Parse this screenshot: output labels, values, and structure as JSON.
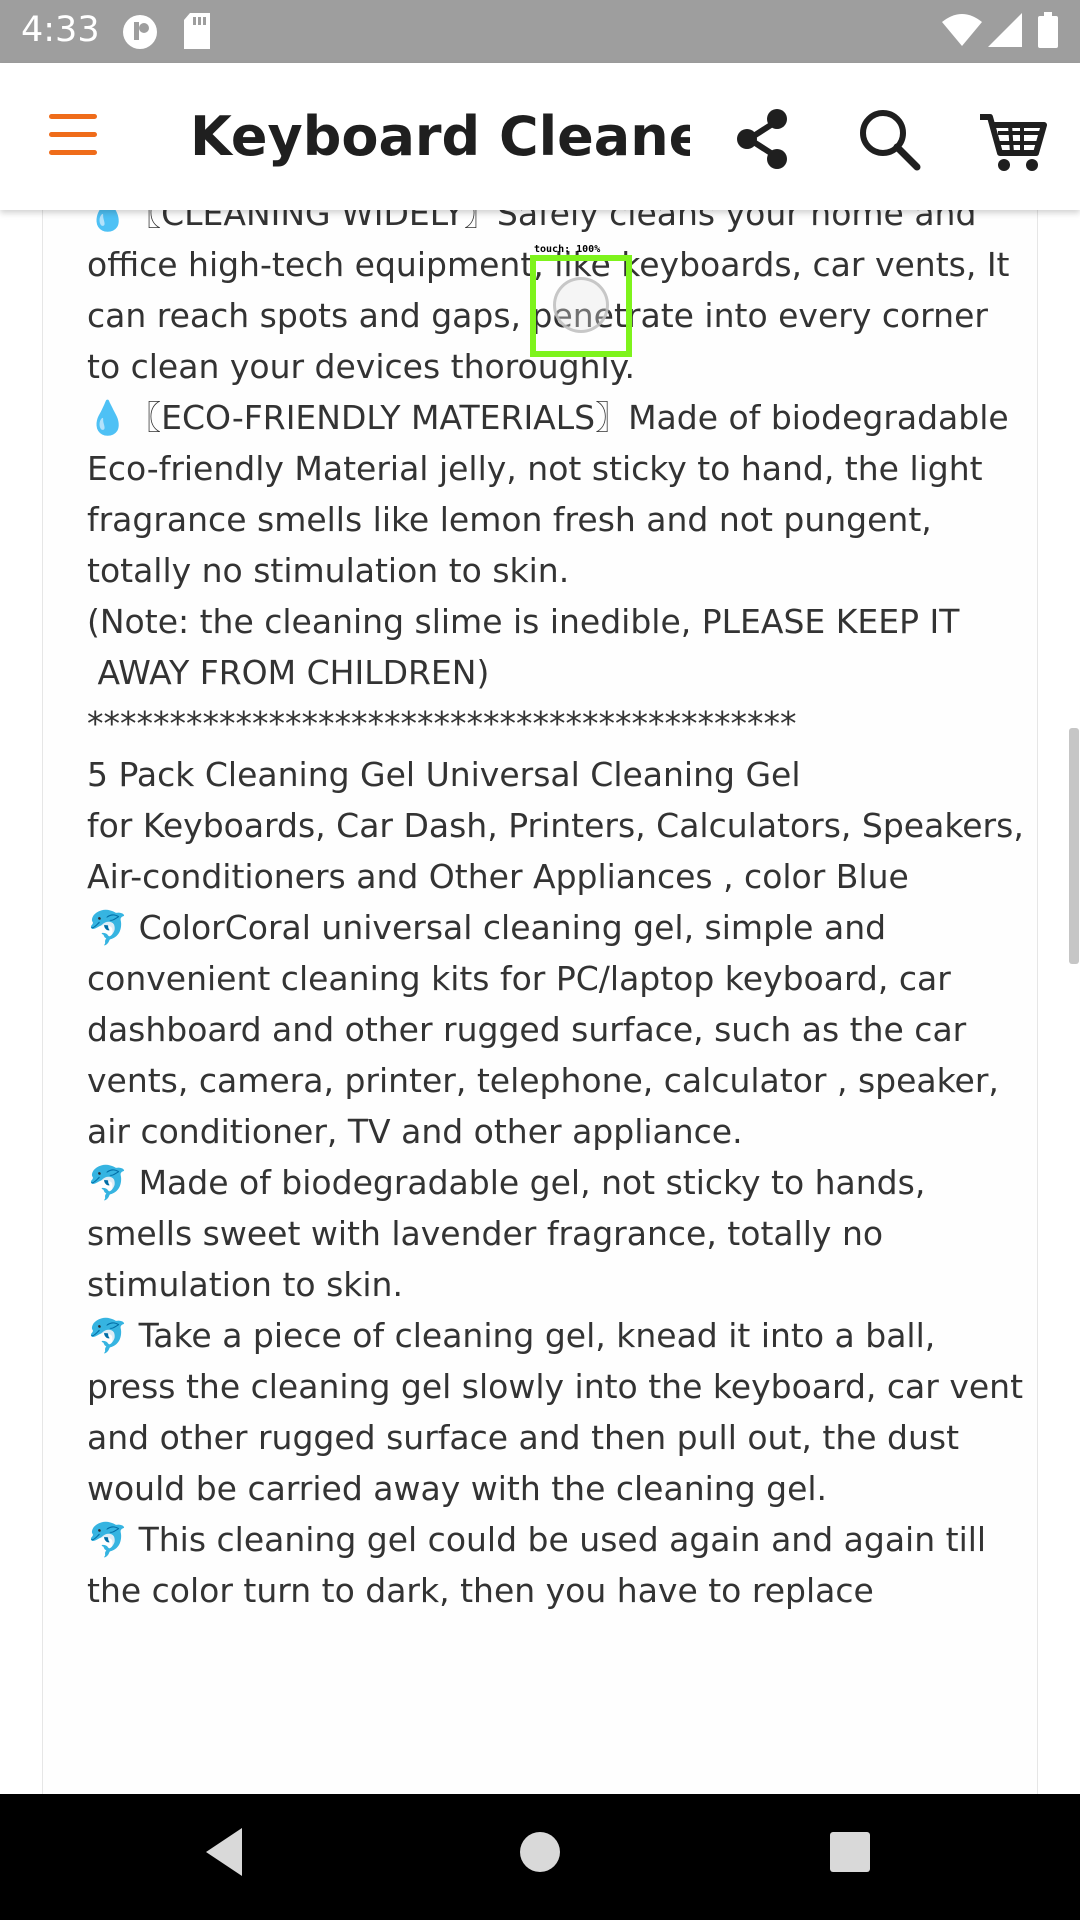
{
  "status_bar": {
    "time": "4:33"
  },
  "app_bar": {
    "title": "Keyboard Cleane...",
    "accent_color": "#ef6c1a",
    "icons": [
      "menu-icon",
      "share-icon",
      "search-icon",
      "cart-icon"
    ]
  },
  "description": {
    "text": "💧〖CLEANING WIDELY〗Safely cleans your home and office high-tech equipment, like keyboards, car vents, It can reach spots and gaps, penetrate into every corner to clean your devices thoroughly.\n💧〖ECO-FRIENDLY MATERIALS〗Made of biodegradable Eco-friendly Material jelly, not sticky to hand, the light fragrance smells like lemon fresh and not pungent, totally no stimulation to skin.\n(Note: the cleaning slime is inedible, PLEASE KEEP IT\n AWAY FROM CHILDREN)\n*******************************************\n5 Pack Cleaning Gel Universal Cleaning Gel\nfor Keyboards, Car Dash, Printers, Calculators, Speakers, Air-conditioners and Other Appliances , color Blue\n🐬 ColorCoral universal cleaning gel, simple and convenient cleaning kits for PC/laptop keyboard, car dashboard and other rugged surface, such as the car vents, camera, printer, telephone, calculator , speaker, air conditioner, TV and other appliance.\n🐬 Made of biodegradable gel, not sticky to hands, smells sweet with lavender fragrance, totally no stimulation to skin.\n🐬 Take a piece of cleaning gel, knead it into a ball, press the cleaning gel slowly into the keyboard, car vent and other rugged surface and then pull out, the dust would be carried away with the cleaning gel.\n🐬 This cleaning gel could be used again and again till the color turn to dark, then you have to replace"
  },
  "touch_overlay": {
    "label": "touch: 100%",
    "color": "#7ef31c"
  },
  "nav_bar": {
    "buttons": [
      "back-icon",
      "home-icon",
      "recents-icon"
    ]
  }
}
